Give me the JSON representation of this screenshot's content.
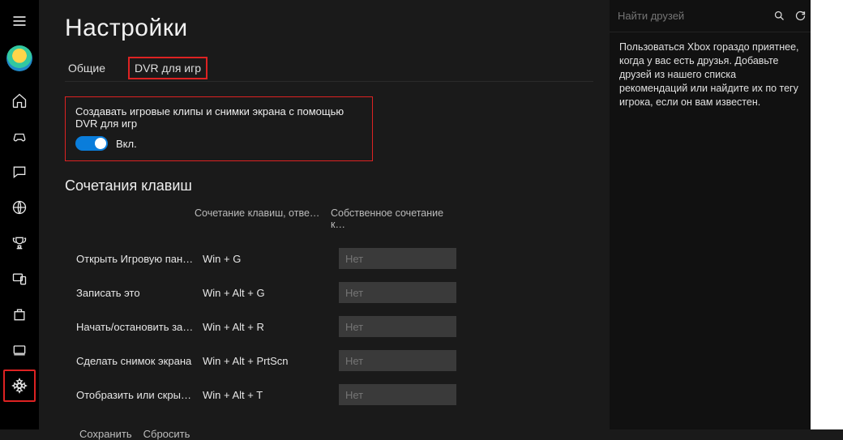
{
  "page_title": "Настройки",
  "tabs": {
    "general": "Общие",
    "dvr": "DVR для игр"
  },
  "dvr_box": {
    "description": "Создавать игровые клипы и снимки экрана с помощью DVR для игр",
    "toggle_label": "Вкл."
  },
  "shortcuts": {
    "section_title": "Сочетания клавиш",
    "col_default": "Сочетание клавиш, отве…",
    "col_custom": "Собственное сочетание к…",
    "rows": [
      {
        "name": "Открыть Игровую пан…",
        "default": "Win + G",
        "custom": "Нет"
      },
      {
        "name": "Записать это",
        "default": "Win + Alt + G",
        "custom": "Нет"
      },
      {
        "name": "Начать/остановить зап…",
        "default": "Win + Alt + R",
        "custom": "Нет"
      },
      {
        "name": "Сделать снимок экрана",
        "default": "Win + Alt + PrtScn",
        "custom": "Нет"
      },
      {
        "name": "Отобразить или скрыт…",
        "default": "Win + Alt + T",
        "custom": "Нет"
      }
    ]
  },
  "footer": {
    "save": "Сохранить",
    "reset": "Сбросить"
  },
  "friends_panel": {
    "search_placeholder": "Найти друзей",
    "body": "Пользоваться Xbox гораздо приятнее, когда у вас есть друзья. Добавьте друзей из нашего списка рекомендаций или найдите их по тегу игрока, если он вам известен."
  }
}
